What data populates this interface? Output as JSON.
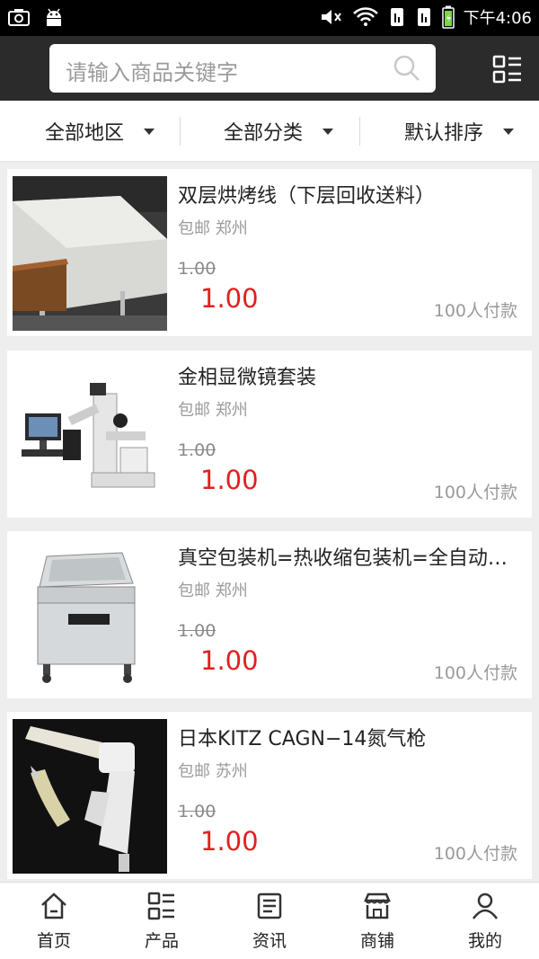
{
  "status_bar": {
    "time": "下午4:06"
  },
  "search": {
    "placeholder": "请输入商品关键字"
  },
  "filters": [
    {
      "label": "全部地区"
    },
    {
      "label": "全部分类"
    },
    {
      "label": "默认排序"
    }
  ],
  "products": [
    {
      "title": "双层烘烤线（下层回收送料）",
      "location": "包邮 郑州",
      "old_price": "1.00",
      "price": "1.00",
      "sold": "100人付款",
      "image": "oven-line"
    },
    {
      "title": "金相显微镜套装",
      "location": "包邮 郑州",
      "old_price": "1.00",
      "price": "1.00",
      "sold": "100人付款",
      "image": "microscope"
    },
    {
      "title": "真空包装机=热收缩包装机=全自动包装机",
      "location": "包邮 郑州",
      "old_price": "1.00",
      "price": "1.00",
      "sold": "100人付款",
      "image": "vacuum-packer"
    },
    {
      "title": "日本KITZ CAGN−14氮气枪",
      "location": "包邮 苏州",
      "old_price": "1.00",
      "price": "1.00",
      "sold": "100人付款",
      "image": "nitrogen-gun"
    }
  ],
  "bottom_nav": [
    {
      "label": "首页",
      "icon": "home-icon"
    },
    {
      "label": "产品",
      "icon": "grid-list-icon"
    },
    {
      "label": "资讯",
      "icon": "news-icon"
    },
    {
      "label": "商铺",
      "icon": "store-icon"
    },
    {
      "label": "我的",
      "icon": "user-icon"
    }
  ],
  "colors": {
    "header_bg": "#2b2b2b",
    "price_red": "#e02020",
    "page_bg": "#eeeeee"
  }
}
